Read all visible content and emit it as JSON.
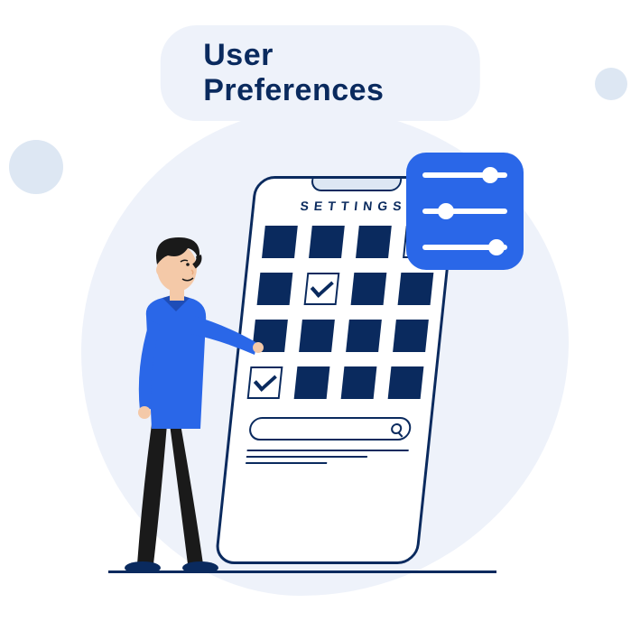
{
  "header": {
    "title": "User Preferences"
  },
  "phone": {
    "title": "SETTINGS",
    "grid": [
      {
        "checked": false
      },
      {
        "checked": false
      },
      {
        "checked": false
      },
      {
        "checked": true
      },
      {
        "checked": false
      },
      {
        "checked": true
      },
      {
        "checked": false
      },
      {
        "checked": false
      },
      {
        "checked": false
      },
      {
        "checked": false
      },
      {
        "checked": false
      },
      {
        "checked": false
      },
      {
        "checked": true
      },
      {
        "checked": false
      },
      {
        "checked": false
      },
      {
        "checked": false
      }
    ]
  },
  "sliders": [
    {
      "knob_position_pct": 70
    },
    {
      "knob_position_pct": 18
    },
    {
      "knob_position_pct": 78
    }
  ],
  "colors": {
    "accent": "#2a67e8",
    "dark": "#0a2a5e",
    "bg_light": "#eef2fa"
  }
}
